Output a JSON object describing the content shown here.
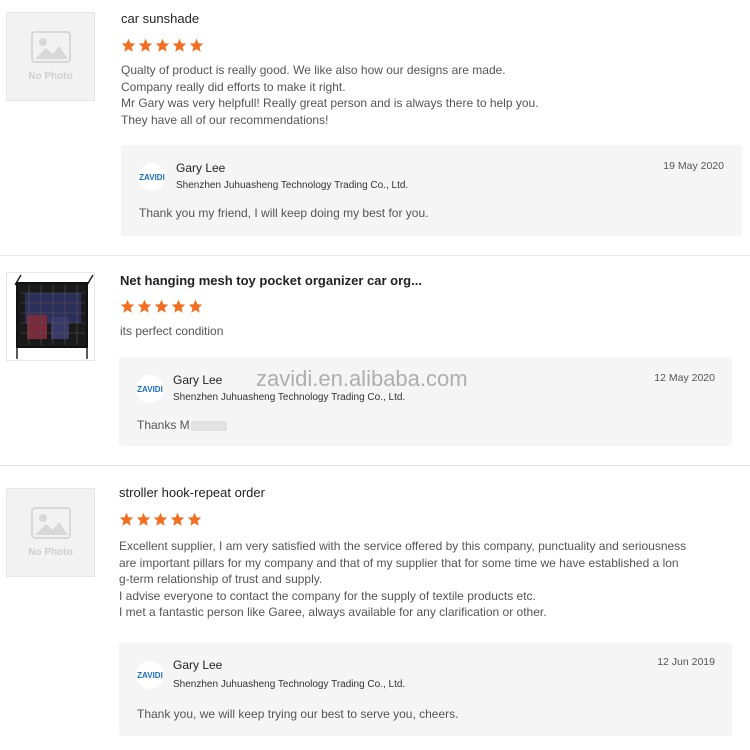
{
  "reviews": [
    {
      "thumb_text": "No Photo",
      "title": "car sunshade",
      "rating": 5,
      "text": "Qualty of product is really good. We like also how our designs are made.\nCompany really did efforts to make it right.\nMr Gary was very helpfull! Really great person and is always there to help you.\nThey have all of our recommendations!",
      "reply": {
        "logo_text": "ZAVIDI",
        "name": "Gary Lee",
        "company": "Shenzhen Juhuasheng Technology Trading Co., Ltd.",
        "date": "19 May 2020",
        "message": "Thank you my friend, I will keep doing my best for you."
      }
    },
    {
      "title": "Net hanging mesh toy pocket organizer car org...",
      "rating": 5,
      "text": "its perfect  condition",
      "reply": {
        "logo_text": "ZAVIDI",
        "name": "Gary Lee",
        "company": "Shenzhen Juhuasheng Technology Trading Co., Ltd.",
        "date": "12 May 2020",
        "message": "Thanks M"
      }
    },
    {
      "thumb_text": "No Photo",
      "title": "stroller hook-repeat order",
      "rating": 5,
      "text": "Excellent supplier, I am very satisfied with the service offered by this company, punctuality and seriousness\nare important pillars for my company and that of my supplier that for some time we have established a lon\ng-term relationship of trust and supply.\nI advise everyone to contact the company for the supply of textile products etc.\nI met a fantastic person like Garee, always available for any clarification or other.",
      "reply": {
        "logo_text": "ZAVIDI",
        "name": "Gary Lee",
        "company": "Shenzhen Juhuasheng Technology Trading Co., Ltd.",
        "date": "12 Jun 2019",
        "message": "Thank you, we will keep trying our best to serve you, cheers."
      }
    }
  ],
  "watermark": "zavidi.en.alibaba.com",
  "colors": {
    "star": "#f26e21",
    "reply_bg": "#f5f5f5",
    "divider": "#e6e6e6"
  }
}
